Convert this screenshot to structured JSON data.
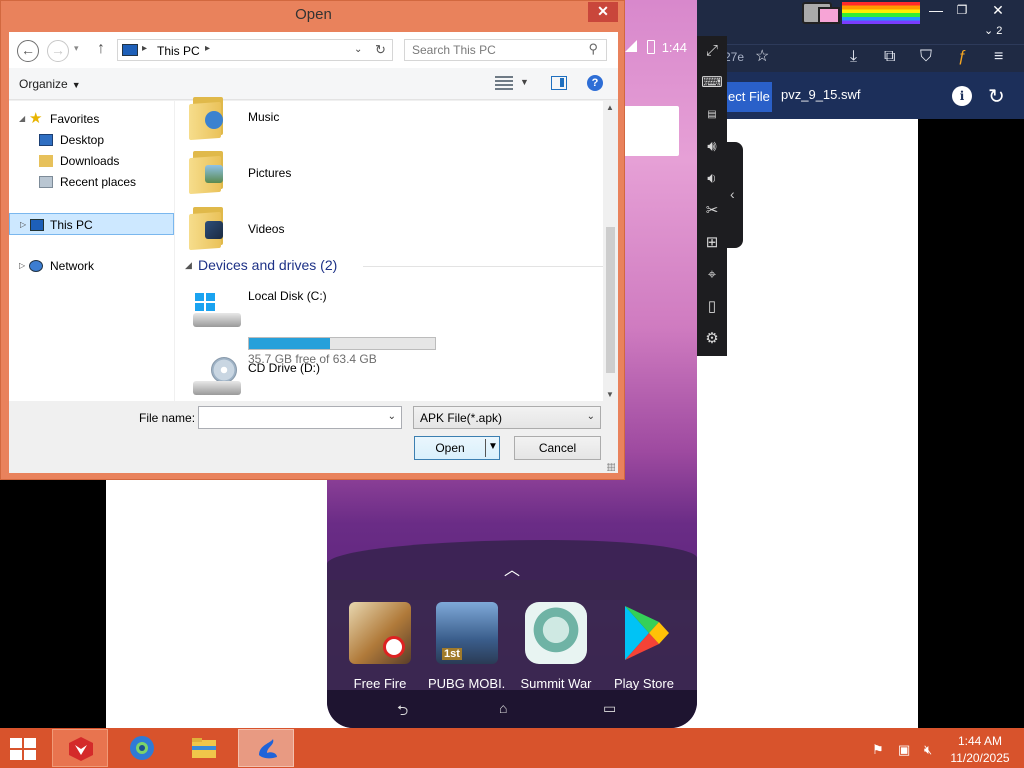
{
  "dialog": {
    "title": "Open",
    "nav": {
      "address_path": "This PC",
      "search_placeholder": "Search This PC"
    },
    "toolbar": {
      "organize_label": "Organize"
    },
    "tree": [
      {
        "label": "Favorites",
        "level": 0,
        "expanded": true
      },
      {
        "label": "Desktop",
        "level": 1
      },
      {
        "label": "Downloads",
        "level": 1
      },
      {
        "label": "Recent places",
        "level": 1
      },
      {
        "label": "This PC",
        "level": 0,
        "selected": true
      },
      {
        "label": "Network",
        "level": 0
      }
    ],
    "folders": [
      {
        "name": "Music"
      },
      {
        "name": "Pictures"
      },
      {
        "name": "Videos"
      }
    ],
    "drives_section": {
      "title": "Devices and drives (2)"
    },
    "drives": [
      {
        "name": "Local Disk (C:)",
        "free_text": "35.7 GB free of 63.4 GB",
        "used_fraction": 0.437
      },
      {
        "name": "CD Drive (D:)"
      }
    ],
    "filename_label": "File name:",
    "filename_value": "",
    "filter_value": "APK File(*.apk)",
    "open_label": "Open",
    "cancel_label": "Cancel"
  },
  "browser": {
    "address_fragment": "27e",
    "tab_count": "2",
    "select_file_label": "ect File",
    "file_name": "pvz_9_15.swf"
  },
  "phone": {
    "status_time": "1:44",
    "dock_apps": [
      {
        "label": "Free Fire"
      },
      {
        "label": "PUBG MOBI..."
      },
      {
        "label": "Summit War"
      },
      {
        "label": "Play Store"
      }
    ]
  },
  "taskbar": {
    "clock_time": "1:44 AM",
    "clock_date": "11/20/2025"
  },
  "colors": {
    "taskbar": "#d8532c",
    "dialog_frame": "#e9825c",
    "selection": "#cde8ff",
    "drive_bar": "#26a0da",
    "section_heading": "#1e3287"
  }
}
